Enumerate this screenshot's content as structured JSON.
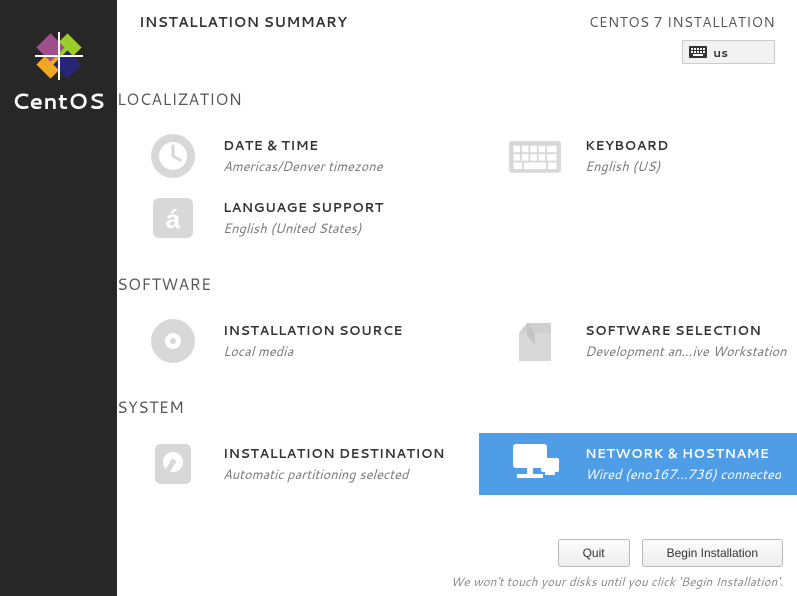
{
  "brand": "CentOS",
  "header": {
    "title": "INSTALLATION SUMMARY",
    "subtitle": "CENTOS 7 INSTALLATION",
    "kbd": "us"
  },
  "sections": {
    "localization": {
      "title": "LOCALIZATION",
      "datetime": {
        "label": "DATE & TIME",
        "value": "Americas/Denver timezone"
      },
      "keyboard": {
        "label": "KEYBOARD",
        "value": "English (US)"
      },
      "language": {
        "label": "LANGUAGE SUPPORT",
        "value": "English (United States)"
      }
    },
    "software": {
      "title": "SOFTWARE",
      "source": {
        "label": "INSTALLATION SOURCE",
        "value": "Local media"
      },
      "selection": {
        "label": "SOFTWARE SELECTION",
        "value": "Development an…ive Workstation"
      }
    },
    "system": {
      "title": "SYSTEM",
      "destination": {
        "label": "INSTALLATION DESTINATION",
        "value": "Automatic partitioning selected"
      },
      "network": {
        "label": "NETWORK & HOSTNAME",
        "value": "Wired (eno167…736) connected"
      }
    }
  },
  "footer": {
    "quit": "Quit",
    "begin": "Begin Installation",
    "note": "We won't touch your disks until you click 'Begin Installation'."
  }
}
